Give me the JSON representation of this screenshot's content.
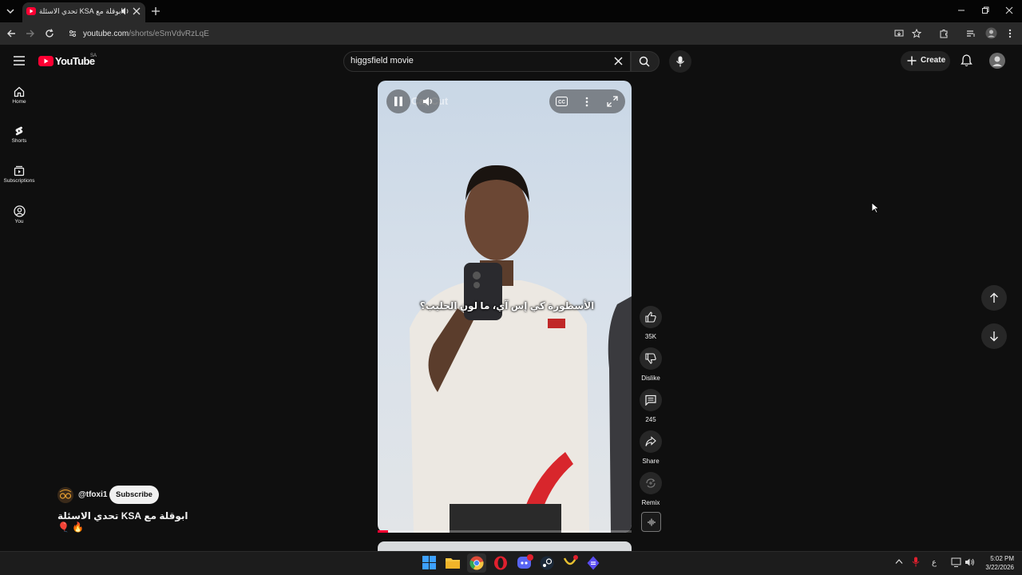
{
  "browser": {
    "tab_title": "ابوقلة مع KSA تحدي الاسئلة",
    "url_host": "youtube.com",
    "url_path": "/shorts/eSmVdvRzLqE"
  },
  "youtube": {
    "logo_text": "YouTube",
    "region": "SA",
    "search_value": "higgsfield movie",
    "create_label": "Create",
    "sidebar": [
      {
        "label": "Home",
        "icon": "home-icon"
      },
      {
        "label": "Shorts",
        "icon": "shorts-icon"
      },
      {
        "label": "Subscriptions",
        "icon": "subscriptions-icon"
      },
      {
        "label": "You",
        "icon": "you-icon"
      }
    ]
  },
  "video": {
    "caption": "الأسطورة كي إس آي، ما لون الحليب؟",
    "watermark": "CapCut",
    "progress": 0.04
  },
  "actions": {
    "like_count": "35K",
    "dislike_label": "Dislike",
    "comment_count": "245",
    "share_label": "Share",
    "remix_label": "Remix"
  },
  "channel": {
    "handle": "@tfoxi1",
    "subscribe_label": "Subscribe",
    "title": "ابوقلة مع KSA تحدي الاسئلة 🔥 🎈"
  },
  "taskbar": {
    "time": "5:02 PM",
    "date": "3/22/2026",
    "lang": "ع"
  },
  "colors": {
    "brand_red": "#ff0033",
    "background": "#0f0f0f"
  }
}
